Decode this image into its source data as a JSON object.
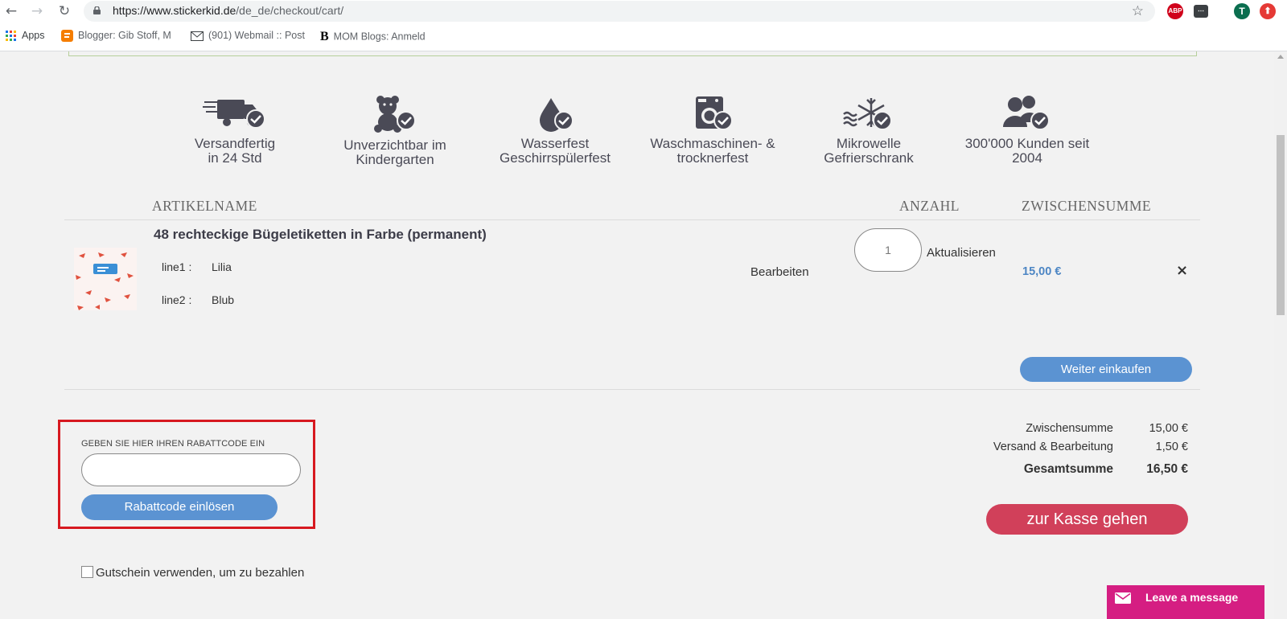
{
  "browser": {
    "url_host": "https://www.stickerkid.de",
    "url_path": "/de_de/checkout/cart/",
    "bookmarks": [
      {
        "label": "Apps"
      },
      {
        "label": "Blogger: Gib Stoff, M"
      },
      {
        "label": "(901) Webmail :: Post"
      },
      {
        "label": "MOM Blogs: Anmeld"
      }
    ],
    "profile_initial": "T",
    "abp_label": "ABP"
  },
  "features": [
    {
      "icon": "truck-check-icon",
      "line1": "Versandfertig",
      "line2": "in 24 Std"
    },
    {
      "icon": "teddy-bear-check-icon",
      "line1": "Unverzichtbar im",
      "line2": "Kindergarten"
    },
    {
      "icon": "water-drop-check-icon",
      "line1": "Wasserfest",
      "line2": "Geschirrspülerfest"
    },
    {
      "icon": "washing-machine-check-icon",
      "line1": "Waschmaschinen- &",
      "line2": "trocknerfest"
    },
    {
      "icon": "snowflake-check-icon",
      "line1": "Mikrowelle",
      "line2": "Gefrierschrank"
    },
    {
      "icon": "customers-check-icon",
      "line1": "300'000 Kunden seit",
      "line2": "2004"
    }
  ],
  "cart": {
    "headers": {
      "item": "ARTIKELNAME",
      "qty": "ANZAHL",
      "subtotal": "ZWISCHENSUMME"
    },
    "item": {
      "title": "48 rechteckige Bügeletiketten in Farbe (permanent)",
      "options": [
        {
          "label": "line1 :",
          "value": "Lilia"
        },
        {
          "label": "line2 :",
          "value": "Blub"
        }
      ],
      "edit_label": "Bearbeiten",
      "qty": "1",
      "update_label": "Aktualisieren",
      "price": "15,00 €",
      "remove": "×"
    },
    "continue_label": "Weiter einkaufen"
  },
  "coupon": {
    "label": "GEBEN SIE HIER IHREN RABATTCODE EIN",
    "placeholder": "",
    "button": "Rabattcode einlösen"
  },
  "totals": [
    {
      "label": "Zwischensumme",
      "value": "15,00 €"
    },
    {
      "label": "Versand & Bearbeitung",
      "value": "1,50 €"
    },
    {
      "label": "Gesamtsumme",
      "value": "16,50 €"
    }
  ],
  "checkout_label": "zur Kasse gehen",
  "voucher_label": "Gutschein verwenden, um zu bezahlen",
  "chat_label": "Leave a message",
  "colors": {
    "accent_blue": "#5b93d2",
    "checkout_red": "#d1405a",
    "highlight_red": "#d71920",
    "chat_pink": "#d51e82",
    "icon_gray": "#4a4a56"
  }
}
